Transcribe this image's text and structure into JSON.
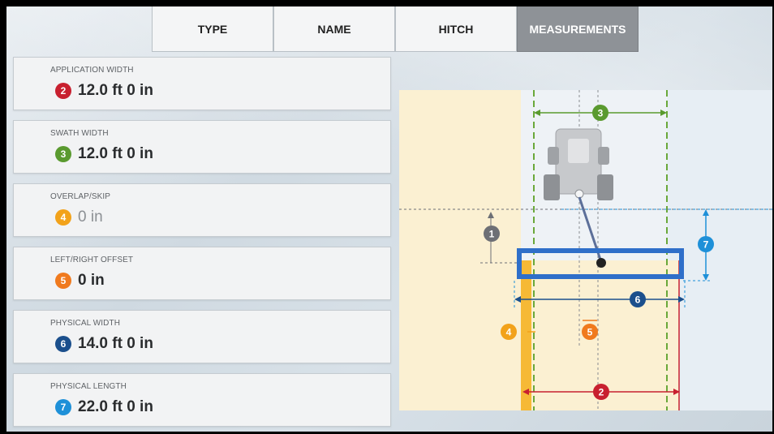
{
  "tabs": [
    {
      "label": "TYPE"
    },
    {
      "label": "NAME"
    },
    {
      "label": "HITCH"
    },
    {
      "label": "MEASUREMENTS",
      "active": true
    }
  ],
  "fields": [
    {
      "label": "APPLICATION WIDTH",
      "badge": "2",
      "badge_color": "#c8202f",
      "value": "12.0 ft 0 in"
    },
    {
      "label": "SWATH WIDTH",
      "badge": "3",
      "badge_color": "#5a9a2f",
      "value": "12.0 ft 0 in"
    },
    {
      "label": "OVERLAP/SKIP",
      "badge": "4",
      "badge_color": "#f2a21a",
      "value": "0 in",
      "muted": true
    },
    {
      "label": "LEFT/RIGHT OFFSET",
      "badge": "5",
      "badge_color": "#f07a1e",
      "value": "0 in"
    },
    {
      "label": "PHYSICAL WIDTH",
      "badge": "6",
      "badge_color": "#1b4f8c",
      "value": "14.0 ft 0 in"
    },
    {
      "label": "PHYSICAL LENGTH",
      "badge": "7",
      "badge_color": "#1e90d8",
      "value": "22.0 ft 0 in"
    }
  ],
  "diagram": {
    "markers": [
      {
        "id": "1",
        "color": "#6d6f75"
      },
      {
        "id": "2",
        "color": "#c8202f"
      },
      {
        "id": "3",
        "color": "#5a9a2f"
      },
      {
        "id": "4",
        "color": "#f2a21a"
      },
      {
        "id": "5",
        "color": "#f07a1e"
      },
      {
        "id": "6",
        "color": "#1b4f8c"
      },
      {
        "id": "7",
        "color": "#1e90d8"
      }
    ]
  }
}
